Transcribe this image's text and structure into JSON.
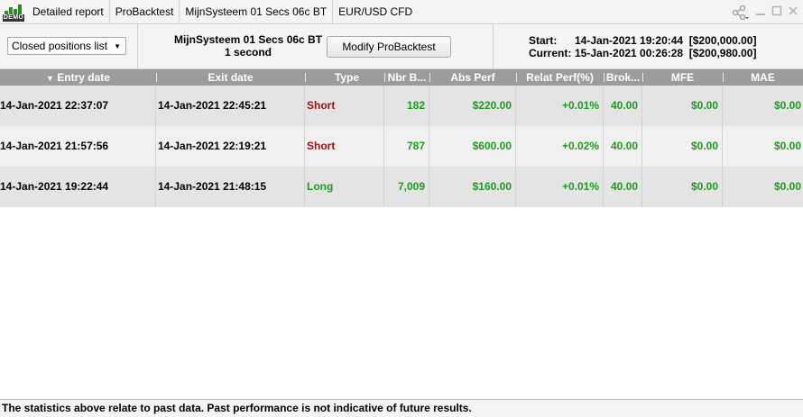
{
  "titlebar": {
    "badge": "DEMO",
    "tabs": [
      "Detailed report",
      "ProBacktest",
      "MijnSysteem 01 Secs 06c BT",
      "EUR/USD CFD"
    ]
  },
  "toolbar": {
    "view_select": "Closed positions list",
    "system_name": "MijnSysteem 01 Secs 06c BT",
    "interval": "1 second",
    "modify_button": "Modify ProBacktest",
    "start_label": "Start:",
    "start_value": "14-Jan-2021 19:20:44  [$200,000.00]",
    "current_label": "Current:",
    "current_value": "15-Jan-2021 00:26:28  [$200,980.00]"
  },
  "table": {
    "sort_indicator": "▼",
    "columns": [
      "Entry date",
      "Exit date",
      "Type",
      "Nbr B...",
      "Abs Perf",
      "Relat Perf(%)",
      "Brok...",
      "MFE",
      "MAE"
    ],
    "rows": [
      [
        "14-Jan-2021 22:37:07",
        "14-Jan-2021 22:45:21",
        "Short",
        "182",
        "$220.00",
        "+0.01%",
        "40.00",
        "$0.00",
        "$0.00"
      ],
      [
        "14-Jan-2021 21:57:56",
        "14-Jan-2021 22:19:21",
        "Short",
        "787",
        "$600.00",
        "+0.02%",
        "40.00",
        "$0.00",
        "$0.00"
      ],
      [
        "14-Jan-2021 19:22:44",
        "14-Jan-2021 21:48:15",
        "Long",
        "7,009",
        "$160.00",
        "+0.01%",
        "40.00",
        "$0.00",
        "$0.00"
      ]
    ]
  },
  "footer": {
    "disclaimer": "The statistics above relate to past data. Past performance is not indicative of future results."
  },
  "colors": {
    "positive": "#1c9b1c",
    "short": "#a01010",
    "header_bg": "#9c9c9c"
  }
}
